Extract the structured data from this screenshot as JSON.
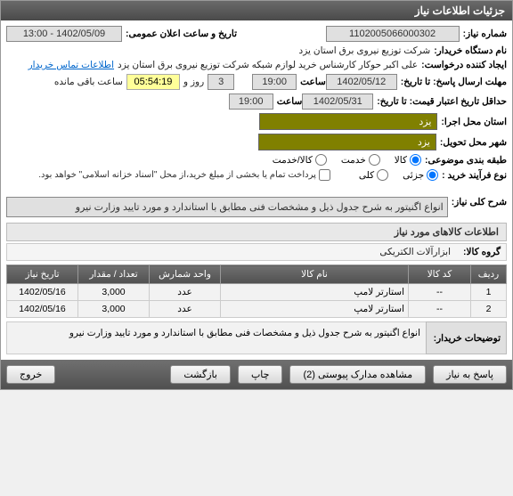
{
  "header": {
    "title": "جزئیات اطلاعات نیاز"
  },
  "form": {
    "need_no_label": "شماره نیاز:",
    "need_no": "1102005066000302",
    "announce_label": "تاریخ و ساعت اعلان عمومی:",
    "announce_val": "1402/05/09 - 13:00",
    "buyer_org_label": "نام دستگاه خریدار:",
    "buyer_org": "شرکت توزیع نیروی برق استان یزد",
    "requester_label": "ایجاد کننده درخواست:",
    "requester": "علی اکبر حوکار  کارشناس خرید لوازم شبکه  شرکت توزیع نیروی برق استان یزد",
    "contact_link": "اطلاعات تماس خریدار",
    "deadline_send_label": "مهلت ارسال پاسخ: تا تاریخ:",
    "deadline_send_date": "1402/05/12",
    "time_label": "ساعت",
    "deadline_send_time": "19:00",
    "remaining_days": "3",
    "remaining_days_label": "روز و",
    "remaining_time": "05:54:19",
    "remaining_suffix": "ساعت باقی مانده",
    "validity_label": "حداقل تاریخ اعتبار قیمت: تا تاریخ:",
    "validity_date": "1402/05/31",
    "validity_time": "19:00",
    "exec_province_label": "استان محل اجرا:",
    "exec_province": "یزد",
    "delivery_city_label": "شهر محل تحویل:",
    "delivery_city": "یزد",
    "category_label": "طبقه بندی موضوعی:",
    "cat_goods": "کالا",
    "cat_service": "خدمت",
    "cat_goods_service": "کالا/خدمت",
    "purchase_type_label": "نوع فرآیند خرید :",
    "pt_partial": "جزئی",
    "pt_total": "کلی",
    "payment_note": "پرداخت تمام یا بخشی از مبلغ خرید،از محل \"اسناد خزانه اسلامی\" خواهد بود.",
    "summary_label": "شرح کلی نیاز:",
    "summary": "انواع اگنیتور   به شرح جدول ذیل و مشخصات فنی مطابق با استاندارد و مورد تایید وزارت نیرو",
    "goods_section": "اطلاعات کالاهای مورد نیاز",
    "goods_group_label": "گروه کالا:",
    "goods_group": "ابزارآلات الکتریکی",
    "buyer_desc_label": "توضیحات خریدار:",
    "buyer_desc": "انواع اگنیتور   به شرح جدول ذیل و مشخصات فنی مطابق با استاندارد و مورد تایید وزارت نیرو"
  },
  "table": {
    "headers": {
      "row": "ردیف",
      "code": "کد کالا",
      "name": "نام کالا",
      "unit": "واحد شمارش",
      "qty": "تعداد / مقدار",
      "date": "تاریخ نیاز"
    },
    "rows": [
      {
        "row": "1",
        "code": "--",
        "name": "استارتر لامپ",
        "unit": "عدد",
        "qty": "3,000",
        "date": "1402/05/16"
      },
      {
        "row": "2",
        "code": "--",
        "name": "استارتر لامپ",
        "unit": "عدد",
        "qty": "3,000",
        "date": "1402/05/16"
      }
    ]
  },
  "buttons": {
    "reply": "پاسخ به نیاز",
    "attachments": "مشاهده مدارک پیوستی (2)",
    "print": "چاپ",
    "back": "بازگشت",
    "exit": "خروج"
  }
}
